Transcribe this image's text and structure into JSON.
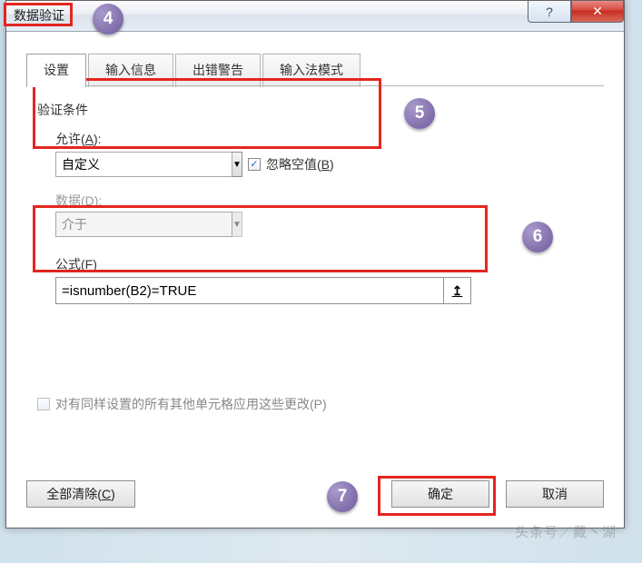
{
  "window": {
    "title": "数据验证",
    "help_icon": "?",
    "close_icon": "✕"
  },
  "tabs": {
    "t1": "设置",
    "t2": "输入信息",
    "t3": "出错警告",
    "t4": "输入法模式"
  },
  "validation": {
    "section_title": "验证条件",
    "allow_label_prefix": "允许(",
    "allow_label_key": "A",
    "allow_label_suffix": "):",
    "allow_value": "自定义",
    "ignore_blank_prefix": "忽略空值(",
    "ignore_blank_key": "B",
    "ignore_blank_suffix": ")",
    "ignore_blank_checked": "✓",
    "data_label_prefix": "数据(",
    "data_label_key": "D",
    "data_label_suffix": "):",
    "data_value": "介于",
    "formula_label_prefix": "公式(",
    "formula_label_key": "F",
    "formula_label_suffix": ")",
    "formula_value": "=isnumber(B2)=TRUE",
    "ref_icon": "↥",
    "apply_all_label": "对有同样设置的所有其他单元格应用这些更改(P)"
  },
  "buttons": {
    "clear_prefix": "全部清除(",
    "clear_key": "C",
    "clear_suffix": ")",
    "ok": "确定",
    "cancel": "取消"
  },
  "badges": {
    "b4": "4",
    "b5": "5",
    "b6": "6",
    "b7": "7"
  },
  "watermark": "头条号／藏丶湖"
}
